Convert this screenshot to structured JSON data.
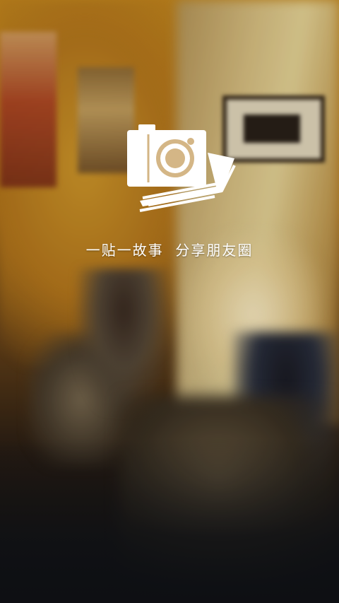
{
  "splash": {
    "tagline": "一贴一故事  分享朋友圈",
    "logo_icon": "photo-stack-camera-icon",
    "background": "blurred-cafe-photo"
  },
  "colors": {
    "logo": "#ffffff",
    "tagline": "#ffffff",
    "wall": "#c88a1e"
  }
}
